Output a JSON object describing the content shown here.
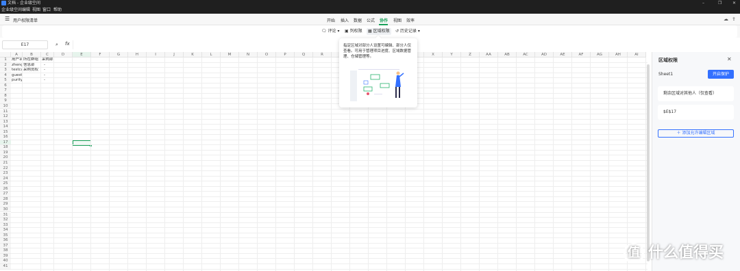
{
  "titlebar": {
    "title": "文档 - 企业级空间",
    "window_controls": [
      "–",
      "❐",
      "✕"
    ]
  },
  "menubar": {
    "items": [
      "企业级空间",
      "编辑",
      "视图",
      "窗口",
      "帮助"
    ]
  },
  "toolbar": {
    "doc_title": "用户权限清单",
    "tabs": [
      "开始",
      "插入",
      "数据",
      "公式",
      "协作",
      "视图",
      "效率"
    ],
    "active_tab": "协作"
  },
  "collab": {
    "comment": "评论",
    "column_perm": "列权限",
    "region_perm": "区域权限",
    "history": "历史记录"
  },
  "formula": {
    "cell_ref": "E17",
    "fx": "fx",
    "value": ""
  },
  "sheet": {
    "columns": [
      "A",
      "B",
      "C",
      "D",
      "E",
      "F",
      "G",
      "H",
      "I",
      "J",
      "K",
      "L",
      "M",
      "N",
      "O",
      "P",
      "Q",
      "R",
      "S",
      "T",
      "U",
      "V",
      "W",
      "X",
      "Y",
      "Z",
      "AA",
      "AB",
      "AC",
      "AD",
      "AE",
      "AF",
      "AG",
      "AH",
      "AI"
    ],
    "rows": [
      "1",
      "2",
      "3",
      "4",
      "5",
      "6",
      "7",
      "8",
      "9",
      "10",
      "11",
      "12",
      "13",
      "14",
      "15",
      "16",
      "17",
      "18",
      "19",
      "20",
      "21",
      "22",
      "23",
      "24",
      "25",
      "26",
      "27",
      "28",
      "29",
      "30",
      "31",
      "32",
      "33",
      "34",
      "35",
      "36",
      "37",
      "38",
      "39",
      "40",
      "41"
    ],
    "cells": [
      [
        "用户名",
        "所在群组",
        "采购部"
      ],
      [
        "zheng",
        "信息部",
        "-"
      ],
      [
        "testcai",
        "采购员权",
        "-"
      ],
      [
        "guest",
        "",
        "-"
      ],
      [
        "purity",
        "",
        "-"
      ]
    ],
    "selected": "E17"
  },
  "popup": {
    "text": "指定区域对部分人设置可编辑、部分人仅查看。可用于管理项目进度、区域数据管理、仓储管理等。"
  },
  "panel": {
    "title": "区域权限",
    "sheet_name": "Sheet1",
    "protect_btn": "开启保护",
    "others_perm": "剩余区域对其他人（仅查看）",
    "range": "$E$17",
    "add_btn": "添加允许编辑区域"
  },
  "watermark": {
    "glyph": "值",
    "text": "什么值得买"
  }
}
